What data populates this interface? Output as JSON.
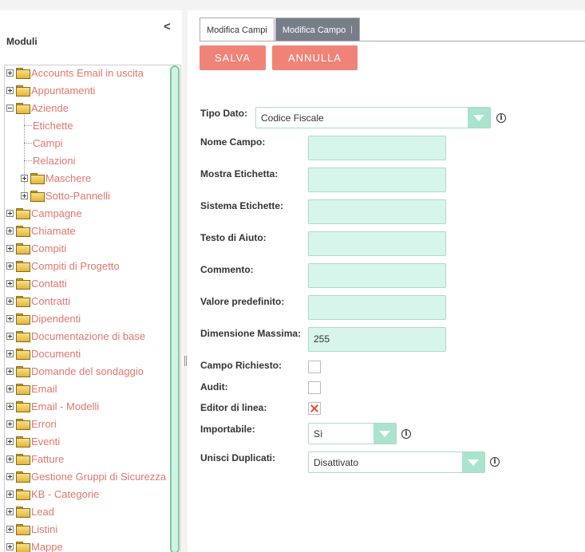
{
  "sidebar": {
    "title": "Moduli",
    "collapse_glyph": "<",
    "tree": [
      {
        "label": "Accounts Email in uscita",
        "expander": "plus",
        "level": 0
      },
      {
        "label": "Appuntamenti",
        "expander": "plus",
        "level": 0
      },
      {
        "label": "Aziende",
        "expander": "minus",
        "level": 0
      },
      {
        "label": "Etichette",
        "expander": "none",
        "level": 1
      },
      {
        "label": "Campi",
        "expander": "none",
        "level": 1
      },
      {
        "label": "Relazioni",
        "expander": "none",
        "level": 1
      },
      {
        "label": "Maschere",
        "expander": "plus",
        "level": 1
      },
      {
        "label": "Sotto-Pannelli",
        "expander": "plus",
        "level": 1
      },
      {
        "label": "Campagne",
        "expander": "plus",
        "level": 0
      },
      {
        "label": "Chiamate",
        "expander": "plus",
        "level": 0
      },
      {
        "label": "Compiti",
        "expander": "plus",
        "level": 0
      },
      {
        "label": "Compiti di Progetto",
        "expander": "plus",
        "level": 0
      },
      {
        "label": "Contatti",
        "expander": "plus",
        "level": 0
      },
      {
        "label": "Contratti",
        "expander": "plus",
        "level": 0
      },
      {
        "label": "Dipendenti",
        "expander": "plus",
        "level": 0
      },
      {
        "label": "Documentazione di base",
        "expander": "plus",
        "level": 0
      },
      {
        "label": "Documenti",
        "expander": "plus",
        "level": 0
      },
      {
        "label": "Domande del sondaggio",
        "expander": "plus",
        "level": 0
      },
      {
        "label": "Email",
        "expander": "plus",
        "level": 0
      },
      {
        "label": "Email - Modelli",
        "expander": "plus",
        "level": 0
      },
      {
        "label": "Errori",
        "expander": "plus",
        "level": 0
      },
      {
        "label": "Eventi",
        "expander": "plus",
        "level": 0
      },
      {
        "label": "Fatture",
        "expander": "plus",
        "level": 0
      },
      {
        "label": "Gestione Gruppi di Sicurezza",
        "expander": "plus",
        "level": 0
      },
      {
        "label": "KB - Categorie",
        "expander": "plus",
        "level": 0
      },
      {
        "label": "Lead",
        "expander": "plus",
        "level": 0
      },
      {
        "label": "Listini",
        "expander": "plus",
        "level": 0
      },
      {
        "label": "Mappe",
        "expander": "plus",
        "level": 0
      }
    ]
  },
  "tabs": {
    "edit_fields": "Modifica Campi",
    "edit_field": "Modifica Campo",
    "separator": "|"
  },
  "actions": {
    "save": "SALVA",
    "cancel": "ANNULLA"
  },
  "form": {
    "data_type": {
      "label": "Tipo Dato:",
      "value": "Codice Fiscale"
    },
    "field_name": {
      "label": "Nome Campo:",
      "value": ""
    },
    "display_label": {
      "label": "Mostra Etichetta:",
      "value": ""
    },
    "system_label": {
      "label": "Sistema Etichette:",
      "value": ""
    },
    "help_text": {
      "label": "Testo di Aiuto:",
      "value": ""
    },
    "comment": {
      "label": "Commento:",
      "value": ""
    },
    "default_value": {
      "label": "Valore predefinito:",
      "value": ""
    },
    "max_size": {
      "label": "Dimensione Massima:",
      "value": "255"
    },
    "required": {
      "label": "Campo Richiesto:",
      "checked": false
    },
    "audit": {
      "label": "Audit:",
      "checked": false
    },
    "inline_edit": {
      "label": "Editor di linea:",
      "checked": true
    },
    "importable": {
      "label": "Importabile:",
      "value": "Sì"
    },
    "merge_duplicates": {
      "label": "Unisci Duplicati:",
      "value": "Disattivato"
    }
  },
  "colors": {
    "accent": "#f08378",
    "input_bg": "#d8f5ec",
    "select_arrow": "#a9e4cd",
    "tree_link": "#e0766d",
    "tab_active": "#777e8a"
  }
}
